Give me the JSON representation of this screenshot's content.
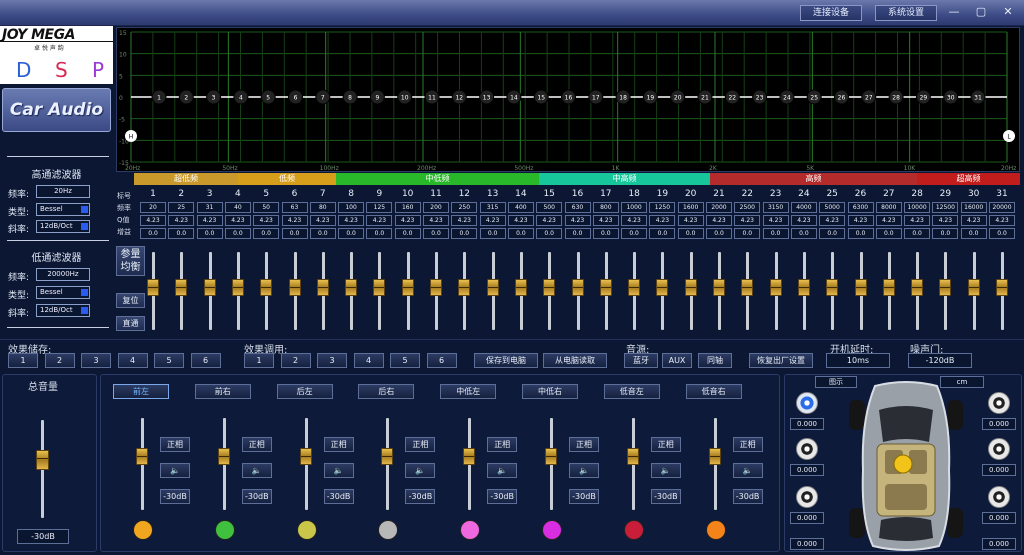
{
  "titlebar": {
    "connect": "连接设备",
    "settings": "系统设置",
    "minimize": "—",
    "restore": "▢",
    "close": "✕"
  },
  "logo": {
    "brand": "JOY MEGA",
    "sub": "卓 悦 声 韵",
    "d": "D",
    "s": "S",
    "p": "P",
    "car_audio": "Car Audio"
  },
  "colors": {
    "d": "#2a62d6",
    "s": "#d62a55",
    "p": "#9a3ad6"
  },
  "hpf": {
    "title": "高通滤波器",
    "freq_label": "频率:",
    "freq": "20Hz",
    "type_label": "类型:",
    "type": "Bessel",
    "slope_label": "斜率:",
    "slope": "12dB/Oct"
  },
  "lpf": {
    "title": "低通滤波器",
    "freq_label": "频率:",
    "freq": "20000Hz",
    "type_label": "类型:",
    "type": "Bessel",
    "slope_label": "斜率:",
    "slope": "12dB/Oct"
  },
  "graph": {
    "y_ticks": [
      "15",
      "10",
      "5",
      "0",
      "-5",
      "-10",
      "-15"
    ],
    "x_ticks": [
      "20Hz",
      "50Hz",
      "100Hz",
      "200Hz",
      "500Hz",
      "1K",
      "2K",
      "5K",
      "10K",
      "20Hz"
    ],
    "markers": [
      "1",
      "2",
      "3",
      "4",
      "5",
      "6",
      "7",
      "8",
      "9",
      "10",
      "11",
      "12",
      "13",
      "14",
      "15",
      "16",
      "17",
      "18",
      "19",
      "20",
      "21",
      "22",
      "23",
      "24",
      "25",
      "26",
      "27",
      "28",
      "29",
      "30",
      "31"
    ],
    "h_marker": "H",
    "l_marker": "L"
  },
  "bands": [
    {
      "label": "超低频",
      "color": "#c99a2b"
    },
    {
      "label": "低频",
      "color": "#d79e1b"
    },
    {
      "label": "中低频",
      "color": "#29b829"
    },
    {
      "label": "中高频",
      "color": "#18c69b"
    },
    {
      "label": "高频",
      "color": "#b32b2b"
    },
    {
      "label": "超高频",
      "color": "#c21d1d"
    }
  ],
  "table": {
    "row_labels": [
      "标号",
      "频率",
      "Q值",
      "增益"
    ],
    "freqs": [
      "20",
      "25",
      "31",
      "40",
      "50",
      "63",
      "80",
      "100",
      "125",
      "160",
      "200",
      "250",
      "315",
      "400",
      "500",
      "630",
      "800",
      "1000",
      "1250",
      "1600",
      "2000",
      "2500",
      "3150",
      "4000",
      "5000",
      "6300",
      "8000",
      "10000",
      "12500",
      "16000",
      "20000"
    ],
    "q": "4.23",
    "gain": "0.0"
  },
  "eq_buttons": {
    "param_eq": "参量均衡",
    "reset": "复位",
    "bypass": "直通"
  },
  "presets": {
    "save_label": "效果储存:",
    "load_label": "效果调用:",
    "nums": [
      "1",
      "2",
      "3",
      "4",
      "5",
      "6"
    ],
    "save_pc": "保存到电脑",
    "load_pc": "从电脑读取"
  },
  "source": {
    "label": "音源:",
    "items": [
      "蓝牙",
      "AUX",
      "同轴"
    ],
    "factory": "恢复出厂设置"
  },
  "boot_delay": {
    "label": "开机延时:",
    "value": "10ms"
  },
  "noise_gate": {
    "label": "噪声门:",
    "value": "-120dB"
  },
  "master": {
    "title": "总音量",
    "value": "-30dB"
  },
  "channels": [
    {
      "name": "前左",
      "color": "#f0a71f"
    },
    {
      "name": "前右",
      "color": "#3fc13f"
    },
    {
      "name": "后左",
      "color": "#c9c64a"
    },
    {
      "name": "后右",
      "color": "#b8b8b8"
    },
    {
      "name": "中低左",
      "color": "#f068df"
    },
    {
      "name": "中低右",
      "color": "#d82de0"
    },
    {
      "name": "低音左",
      "color": "#c81e3a"
    },
    {
      "name": "低音右",
      "color": "#f4841a"
    }
  ],
  "channel_ctrl": {
    "phase": "正相",
    "db": "-30dB",
    "speaker": "🔈"
  },
  "car": {
    "unit_left": "图示",
    "unit_right": "cm",
    "values": [
      "0.000",
      "0.000",
      "0.000",
      "0.000",
      "0.000",
      "0.000",
      "0.000",
      "0.000"
    ]
  }
}
